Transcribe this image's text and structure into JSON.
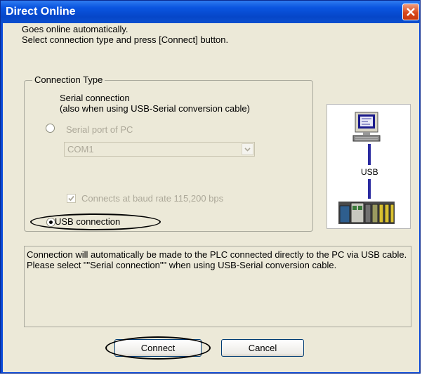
{
  "window": {
    "title": "Direct Online",
    "close_icon": "close-icon"
  },
  "intro": {
    "line1": "Goes online automatically.",
    "line2": "Select connection type and press [Connect] button."
  },
  "connection_type": {
    "group_label": "Connection Type",
    "serial": {
      "label_line1": "Serial connection",
      "label_line2": "(also when using USB-Serial conversion cable)",
      "selected": false
    },
    "serial_port_label": "Serial port of PC",
    "serial_port_value": "COM1",
    "baud_label": "Connects at baud rate 115,200 bps",
    "baud_checked": true,
    "usb": {
      "label": "USB connection",
      "selected": true
    }
  },
  "diagram": {
    "usb_label": "USB",
    "icons": [
      "computer-icon",
      "plc-icon"
    ]
  },
  "description": "Connection will automatically be made to the PLC connected directly to the PC via USB cable.\nPlease select \"\"Serial connection\"\" when using USB-Serial conversion cable.",
  "buttons": {
    "connect": "Connect",
    "cancel": "Cancel"
  },
  "colors": {
    "titlebar": "#0a4ad8",
    "client_bg": "#ece9d8",
    "close_button": "#d9481c",
    "usb_line": "#2a2aa0"
  }
}
